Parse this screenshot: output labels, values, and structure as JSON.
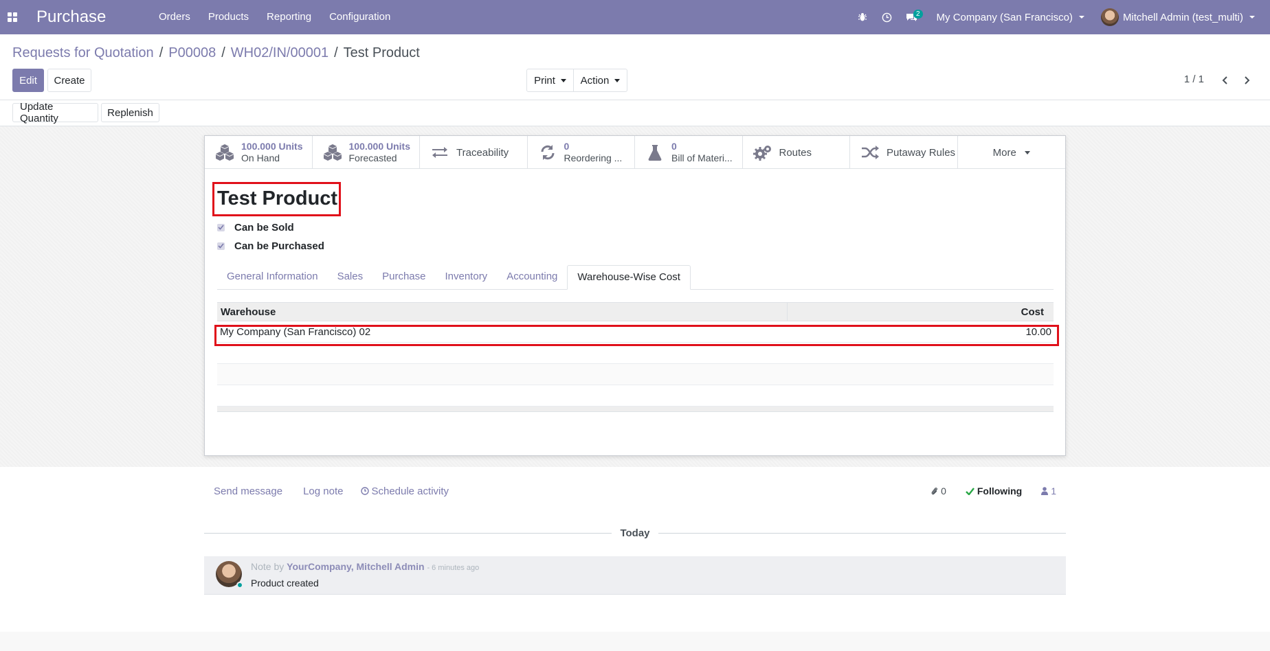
{
  "navbar": {
    "app_name": "Purchase",
    "menu": [
      "Orders",
      "Products",
      "Reporting",
      "Configuration"
    ],
    "message_count": "2",
    "company": "My Company (San Francisco)",
    "user": "Mitchell Admin (test_multi)"
  },
  "breadcrumb": {
    "items": [
      "Requests for Quotation",
      "P00008",
      "WH02/IN/00001"
    ],
    "current": "Test Product"
  },
  "toolbar": {
    "edit_label": "Edit",
    "create_label": "Create",
    "print_label": "Print",
    "action_label": "Action",
    "pager": "1 / 1"
  },
  "header_buttons": {
    "update_quantity": "Update Quantity",
    "replenish": "Replenish"
  },
  "stat_buttons": [
    {
      "value": "100.000 Units",
      "label": "On Hand",
      "icon": "cubes-icon"
    },
    {
      "value": "100.000 Units",
      "label": "Forecasted",
      "icon": "cubes-icon"
    },
    {
      "label": "Traceability",
      "icon": "exchange-icon"
    },
    {
      "value": "0",
      "label": "Reordering ...",
      "icon": "refresh-icon"
    },
    {
      "value": "0",
      "label": "Bill of Materi...",
      "icon": "flask-icon"
    },
    {
      "label": "Routes",
      "icon": "cogs-icon"
    },
    {
      "label": "Putaway Rules",
      "icon": "random-icon"
    },
    {
      "label": "More",
      "icon": "caret-down-icon"
    }
  ],
  "product": {
    "name": "Test Product",
    "can_be_sold_label": "Can be Sold",
    "can_be_purchased_label": "Can be Purchased"
  },
  "tabs": [
    "General Information",
    "Sales",
    "Purchase",
    "Inventory",
    "Accounting",
    "Warehouse-Wise Cost"
  ],
  "active_tab": "Warehouse-Wise Cost",
  "cost_table": {
    "columns": [
      "Warehouse",
      "Cost"
    ],
    "rows": [
      {
        "warehouse": "My Company (San Francisco) 02",
        "cost": "10.00"
      }
    ]
  },
  "chatter": {
    "send_message": "Send message",
    "log_note": "Log note",
    "schedule_activity": "Schedule activity",
    "attachments": "0",
    "following": "Following",
    "followers": "1",
    "day_label": "Today",
    "message": {
      "prefix": "Note by",
      "author": "YourCompany, Mitchell Admin",
      "time": "- 6 minutes ago",
      "body": "Product created"
    }
  },
  "colors": {
    "brand": "#7c7bad",
    "highlight": "#e0101a",
    "online": "#00a09d",
    "following_check": "#28a745"
  }
}
